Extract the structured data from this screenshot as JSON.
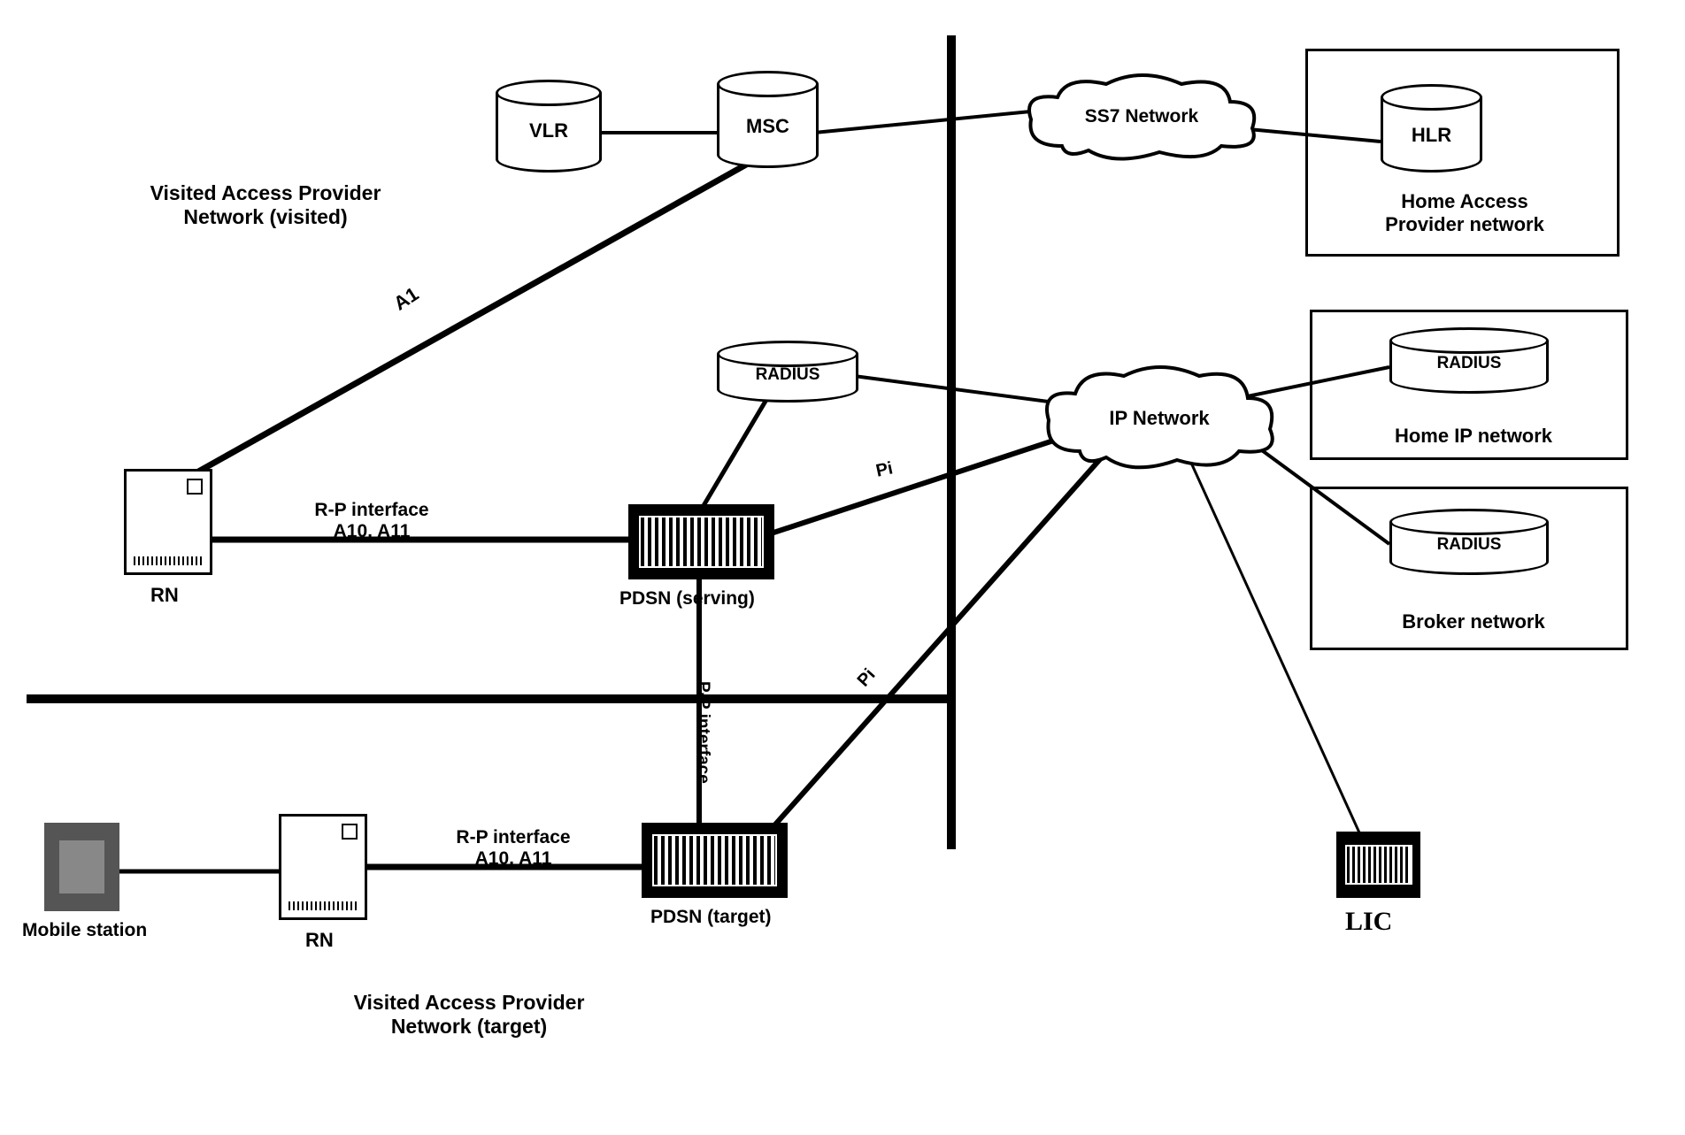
{
  "nodes": {
    "vlr": "VLR",
    "msc": "MSC",
    "hlr": "HLR",
    "radius_visited": "RADIUS",
    "radius_home_ip": "RADIUS",
    "radius_broker": "RADIUS",
    "ss7": "SS7 Network",
    "ip_net": "IP Network",
    "rn1": "RN",
    "rn2": "RN",
    "pdsn_serving": "PDSN (serving)",
    "pdsn_target": "PDSN (target)",
    "mobile_station": "Mobile station",
    "lic": "LIC"
  },
  "boxes": {
    "home_access": "Home Access\nProvider network",
    "home_ip": "Home IP network",
    "broker": "Broker network",
    "visited_access": "Visited Access Provider\nNetwork (visited)",
    "visited_target": "Visited Access Provider\nNetwork (target)"
  },
  "links": {
    "a1": "A1",
    "rp1": "R-P interface\nA10, A11",
    "rp2": "R-P interface\nA10, A11",
    "pp": "P-P interface",
    "pi1": "Pi",
    "pi2": "Pi"
  },
  "chart_data": {
    "type": "network-diagram",
    "nodes": [
      {
        "id": "mobile_station",
        "type": "device",
        "label": "Mobile station"
      },
      {
        "id": "rn1",
        "type": "radio-node",
        "label": "RN",
        "group": "Visited Access Provider Network (visited)"
      },
      {
        "id": "rn2",
        "type": "radio-node",
        "label": "RN",
        "group": "Visited Access Provider Network (target)"
      },
      {
        "id": "vlr",
        "type": "database",
        "label": "VLR",
        "group": "Visited Access Provider Network (visited)"
      },
      {
        "id": "msc",
        "type": "database",
        "label": "MSC",
        "group": "Visited Access Provider Network (visited)"
      },
      {
        "id": "hlr",
        "type": "database",
        "label": "HLR",
        "group": "Home Access Provider network"
      },
      {
        "id": "radius_visited",
        "type": "database",
        "label": "RADIUS",
        "group": "Visited Access Provider Network (visited)"
      },
      {
        "id": "radius_home_ip",
        "type": "database",
        "label": "RADIUS",
        "group": "Home IP network"
      },
      {
        "id": "radius_broker",
        "type": "database",
        "label": "RADIUS",
        "group": "Broker network"
      },
      {
        "id": "pdsn_serving",
        "type": "router",
        "label": "PDSN (serving)",
        "group": "Visited Access Provider Network (visited)"
      },
      {
        "id": "pdsn_target",
        "type": "router",
        "label": "PDSN (target)",
        "group": "Visited Access Provider Network (target)"
      },
      {
        "id": "ss7",
        "type": "cloud",
        "label": "SS7 Network"
      },
      {
        "id": "ip_net",
        "type": "cloud",
        "label": "IP Network"
      },
      {
        "id": "lic",
        "type": "device",
        "label": "LIC"
      }
    ],
    "edges": [
      {
        "from": "vlr",
        "to": "msc"
      },
      {
        "from": "msc",
        "to": "ss7"
      },
      {
        "from": "ss7",
        "to": "hlr"
      },
      {
        "from": "rn1",
        "to": "msc",
        "label": "A1"
      },
      {
        "from": "rn1",
        "to": "pdsn_serving",
        "label": "R-P interface A10, A11"
      },
      {
        "from": "pdsn_serving",
        "to": "radius_visited"
      },
      {
        "from": "pdsn_serving",
        "to": "ip_net",
        "label": "Pi"
      },
      {
        "from": "radius_visited",
        "to": "ip_net"
      },
      {
        "from": "ip_net",
        "to": "radius_home_ip"
      },
      {
        "from": "ip_net",
        "to": "radius_broker"
      },
      {
        "from": "ip_net",
        "to": "lic"
      },
      {
        "from": "pdsn_serving",
        "to": "pdsn_target",
        "label": "P-P interface"
      },
      {
        "from": "pdsn_target",
        "to": "ip_net",
        "label": "Pi"
      },
      {
        "from": "rn2",
        "to": "pdsn_target",
        "label": "R-P interface A10, A11"
      },
      {
        "from": "mobile_station",
        "to": "rn2"
      }
    ],
    "groups": [
      {
        "id": "home_access",
        "label": "Home Access Provider network",
        "contains": [
          "hlr"
        ]
      },
      {
        "id": "home_ip",
        "label": "Home IP network",
        "contains": [
          "radius_home_ip"
        ]
      },
      {
        "id": "broker",
        "label": "Broker network",
        "contains": [
          "radius_broker"
        ]
      },
      {
        "id": "visited",
        "label": "Visited Access Provider Network (visited)",
        "contains": [
          "rn1",
          "vlr",
          "msc",
          "radius_visited",
          "pdsn_serving"
        ]
      },
      {
        "id": "target",
        "label": "Visited Access Provider Network (target)",
        "contains": [
          "rn2",
          "pdsn_target",
          "mobile_station"
        ]
      }
    ]
  }
}
